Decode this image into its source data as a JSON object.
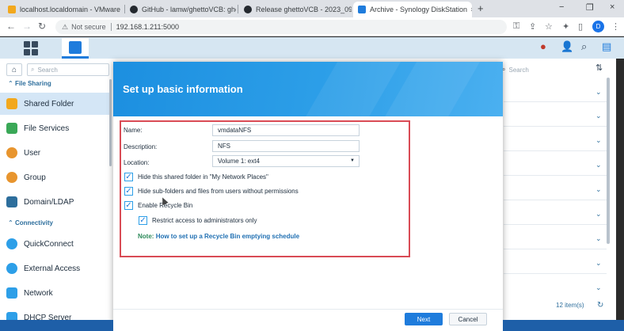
{
  "browser": {
    "tabs": [
      {
        "title": "localhost.localdomain - VMware",
        "close": "×"
      },
      {
        "title": "GitHub - lamw/ghettoVCB: ghet",
        "close": "×"
      },
      {
        "title": "Release ghettoVCB - 2023_09_2",
        "close": "×"
      },
      {
        "title": "Archive - Synology DiskStation",
        "close": "×"
      }
    ],
    "new_tab": "+",
    "window_controls": {
      "minimize": "−",
      "restore": "❐",
      "close": "×"
    },
    "nav": {
      "back": "←",
      "forward": "→",
      "reload": "↻"
    },
    "address": {
      "security": "Not secure",
      "url": "192.168.1.211:5000"
    },
    "profile_initial": "D"
  },
  "sidebar": {
    "search_placeholder": "Search",
    "sections": [
      {
        "label": "File Sharing"
      },
      {
        "label": "Connectivity"
      }
    ],
    "items": [
      {
        "label": "Shared Folder",
        "color": "#f2a81d"
      },
      {
        "label": "File Services",
        "color": "#3aa857"
      },
      {
        "label": "User",
        "color": "#e8952e"
      },
      {
        "label": "Group",
        "color": "#e8952e"
      },
      {
        "label": "Domain/LDAP",
        "color": "#2d6e9c"
      },
      {
        "label": "QuickConnect",
        "color": "#2d9fe8"
      },
      {
        "label": "External Access",
        "color": "#2d9fe8"
      },
      {
        "label": "Network",
        "color": "#2d9fe8"
      },
      {
        "label": "DHCP Server",
        "color": "#2d9fe8"
      }
    ]
  },
  "right_panel": {
    "search_placeholder": "Search",
    "items_count": "12 item(s)"
  },
  "dialog": {
    "title": "Set up basic information",
    "fields": {
      "name_label": "Name:",
      "name_value": "vmdataNFS",
      "description_label": "Description:",
      "description_value": "NFS",
      "location_label": "Location:",
      "location_value": "Volume 1:  ext4"
    },
    "checkboxes": {
      "hide_folder": "Hide this shared folder in \"My Network Places\"",
      "hide_subfolders": "Hide sub-folders and files from users without permissions",
      "enable_recycle": "Enable Recycle Bin",
      "restrict_admin": "Restrict access to administrators only"
    },
    "note_key": "Note:",
    "note_link": "How to set up a Recycle Bin emptying schedule",
    "next_label": "Next",
    "cancel_label": "Cancel"
  },
  "colors": {
    "accent": "#1f7cdc",
    "header_gradient": "#2d9fe8",
    "highlight_box": "#d94b55",
    "sidebar_selected": "#d4e6f6"
  }
}
